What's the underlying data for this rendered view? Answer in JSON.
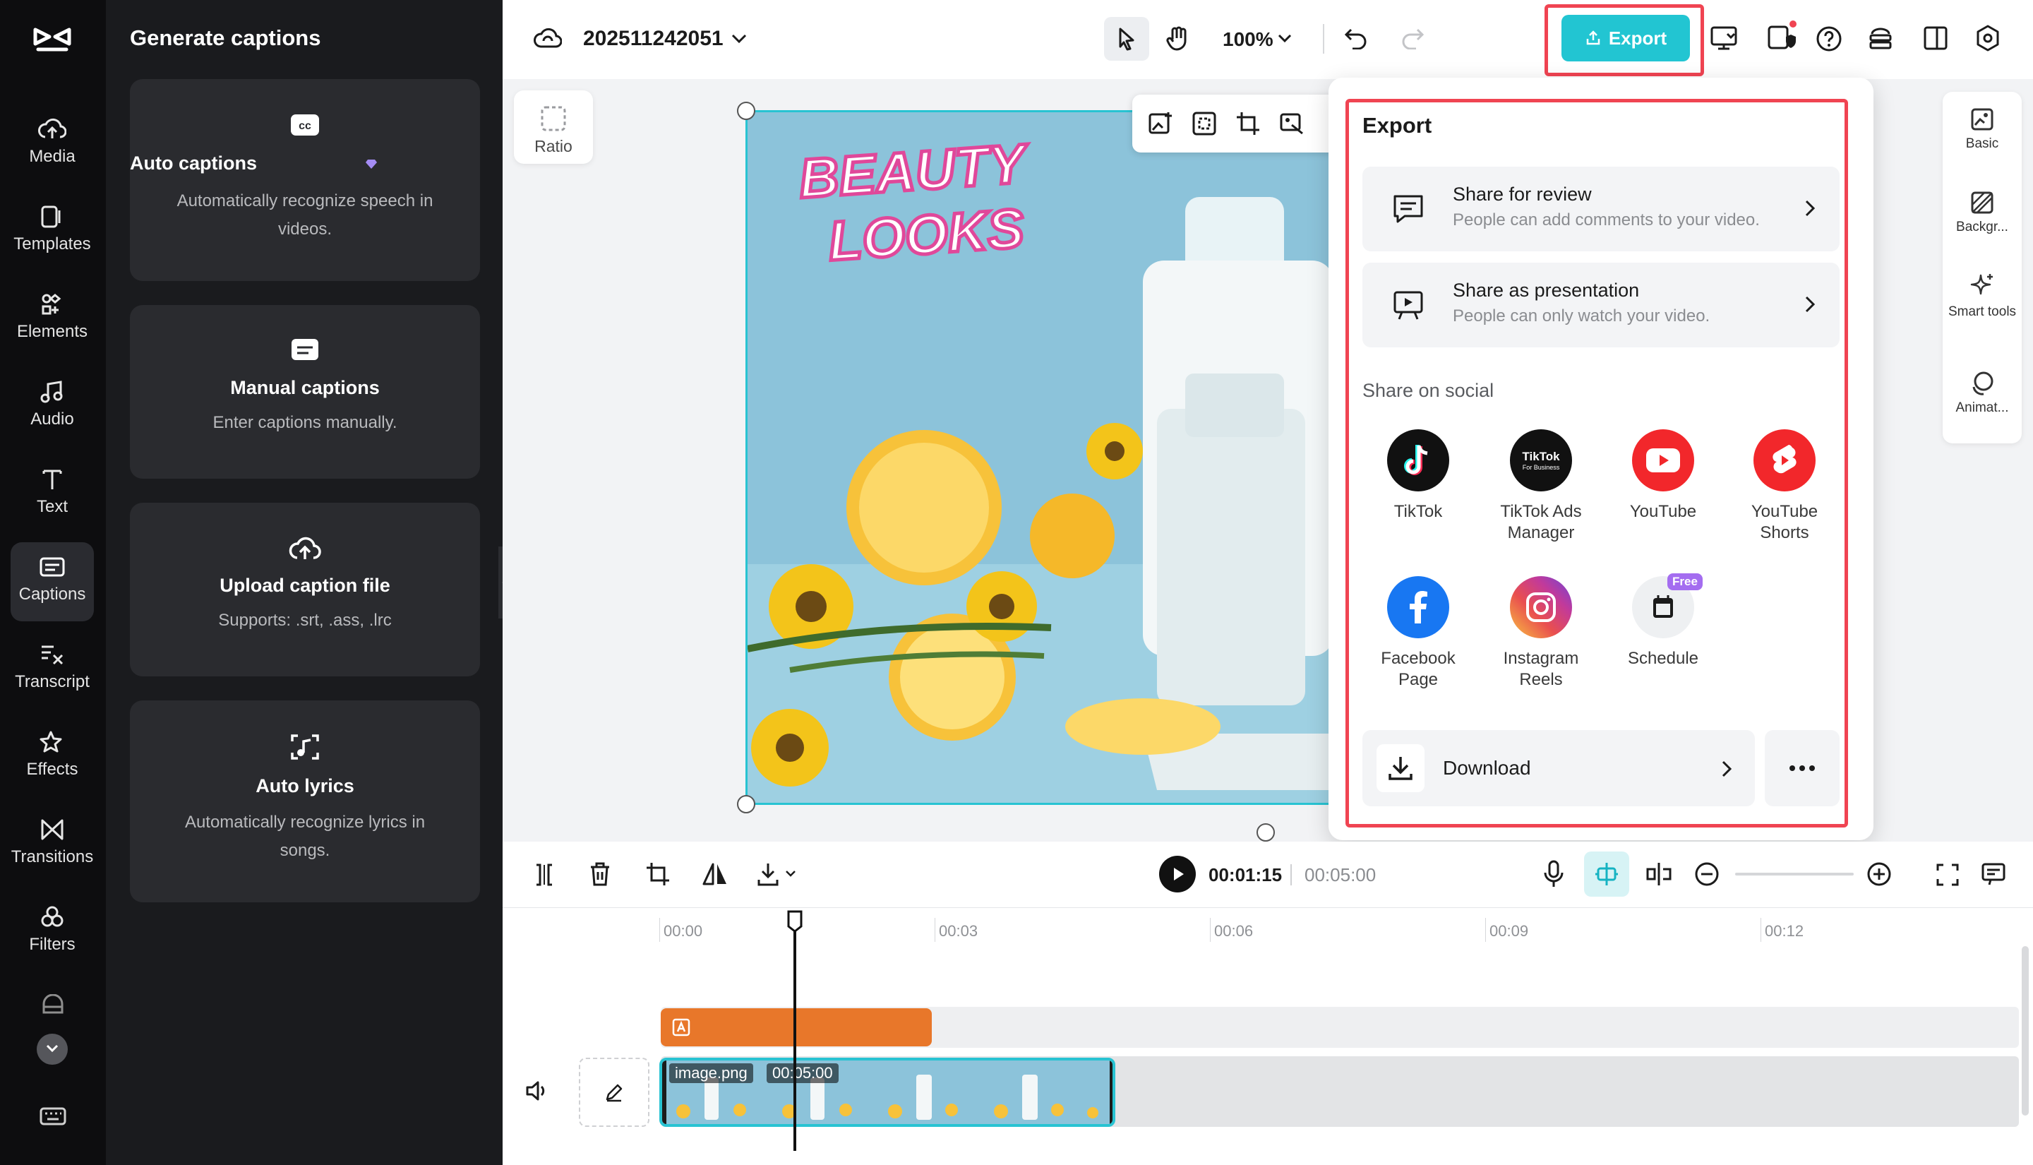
{
  "rail": {
    "items": [
      {
        "label": "Media",
        "icon": "cloud-upload-icon"
      },
      {
        "label": "Templates",
        "icon": "templates-icon"
      },
      {
        "label": "Elements",
        "icon": "elements-icon"
      },
      {
        "label": "Audio",
        "icon": "music-icon"
      },
      {
        "label": "Text",
        "icon": "text-icon"
      },
      {
        "label": "Captions",
        "icon": "captions-icon",
        "active": true
      },
      {
        "label": "Transcript",
        "icon": "transcript-icon"
      },
      {
        "label": "Effects",
        "icon": "effects-icon"
      },
      {
        "label": "Transitions",
        "icon": "transitions-icon"
      },
      {
        "label": "Filters",
        "icon": "filters-icon"
      }
    ]
  },
  "panel": {
    "title": "Generate captions",
    "cards": [
      {
        "title": "Auto captions",
        "desc": "Automatically recognize speech in videos.",
        "icon": "cc-icon"
      },
      {
        "title": "Manual captions",
        "desc": "Enter captions manually.",
        "icon": "manual-captions-icon"
      },
      {
        "title": "Upload caption file",
        "desc": "Supports: .srt, .ass, .lrc",
        "icon": "cloud-upload-icon"
      },
      {
        "title": "Auto lyrics",
        "desc": "Automatically recognize lyrics in songs.",
        "icon": "lyrics-icon"
      }
    ]
  },
  "topbar": {
    "project_name": "202511242051",
    "zoom": "100%",
    "export_label": "Export"
  },
  "canvas": {
    "ratio_label": "Ratio",
    "image_text_line1": "BEAUTY",
    "image_text_line2": "LOOKS"
  },
  "props": {
    "items": [
      {
        "label": "Basic",
        "icon": "basic-icon"
      },
      {
        "label": "Backgr...",
        "icon": "background-icon"
      },
      {
        "label": "Smart tools",
        "icon": "sparkle-icon"
      },
      {
        "label": "Animat...",
        "icon": "animation-icon"
      }
    ]
  },
  "export_popover": {
    "title": "Export",
    "share_review": {
      "title": "Share for review",
      "desc": "People can add comments to your video."
    },
    "share_presentation": {
      "title": "Share as presentation",
      "desc": "People can only watch your video."
    },
    "social_title": "Share on social",
    "socials": [
      {
        "label": "TikTok",
        "color": "#111111"
      },
      {
        "label": "TikTok Ads Manager",
        "color": "#111111",
        "logo_text": "TikTok",
        "logo_sub": "For Business"
      },
      {
        "label": "YouTube",
        "color": "#f2272b"
      },
      {
        "label": "YouTube Shorts",
        "color": "#f2272b"
      },
      {
        "label": "Facebook Page",
        "color": "#1877f2"
      },
      {
        "label": "Instagram Reels",
        "color": "#d62976"
      },
      {
        "label": "Schedule",
        "color": "#eef0f2"
      }
    ],
    "free_badge": "Free",
    "download_label": "Download"
  },
  "timeline": {
    "current_time": "00:01:15",
    "total_time": "00:05:00",
    "ticks": [
      "00:00",
      "00:03",
      "00:06",
      "00:09",
      "00:12"
    ],
    "clip_name": "image.png",
    "clip_duration": "00:05:00"
  }
}
